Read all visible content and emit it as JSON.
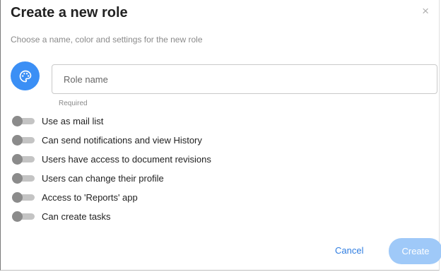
{
  "dialog": {
    "title": "Create a new role",
    "close_symbol": "×",
    "subtitle": "Choose a name, color and settings for the new role"
  },
  "avatar": {
    "icon": "palette-icon",
    "color": "#3b8ff5"
  },
  "role_name": {
    "value": "",
    "placeholder": "Role name",
    "helper": "Required"
  },
  "toggles": [
    {
      "label": "Use as mail list",
      "on": false
    },
    {
      "label": "Can send notifications and view History",
      "on": false
    },
    {
      "label": "Users have access to document revisions",
      "on": false
    },
    {
      "label": "Users can change their profile",
      "on": false
    },
    {
      "label": "Access to 'Reports' app",
      "on": false
    },
    {
      "label": "Can create tasks",
      "on": false
    }
  ],
  "actions": {
    "cancel_label": "Cancel",
    "create_label": "Create",
    "create_enabled": false
  },
  "colors": {
    "accent": "#3b8ff5",
    "link": "#2f7de1",
    "create_disabled": "#9fc9f8"
  }
}
